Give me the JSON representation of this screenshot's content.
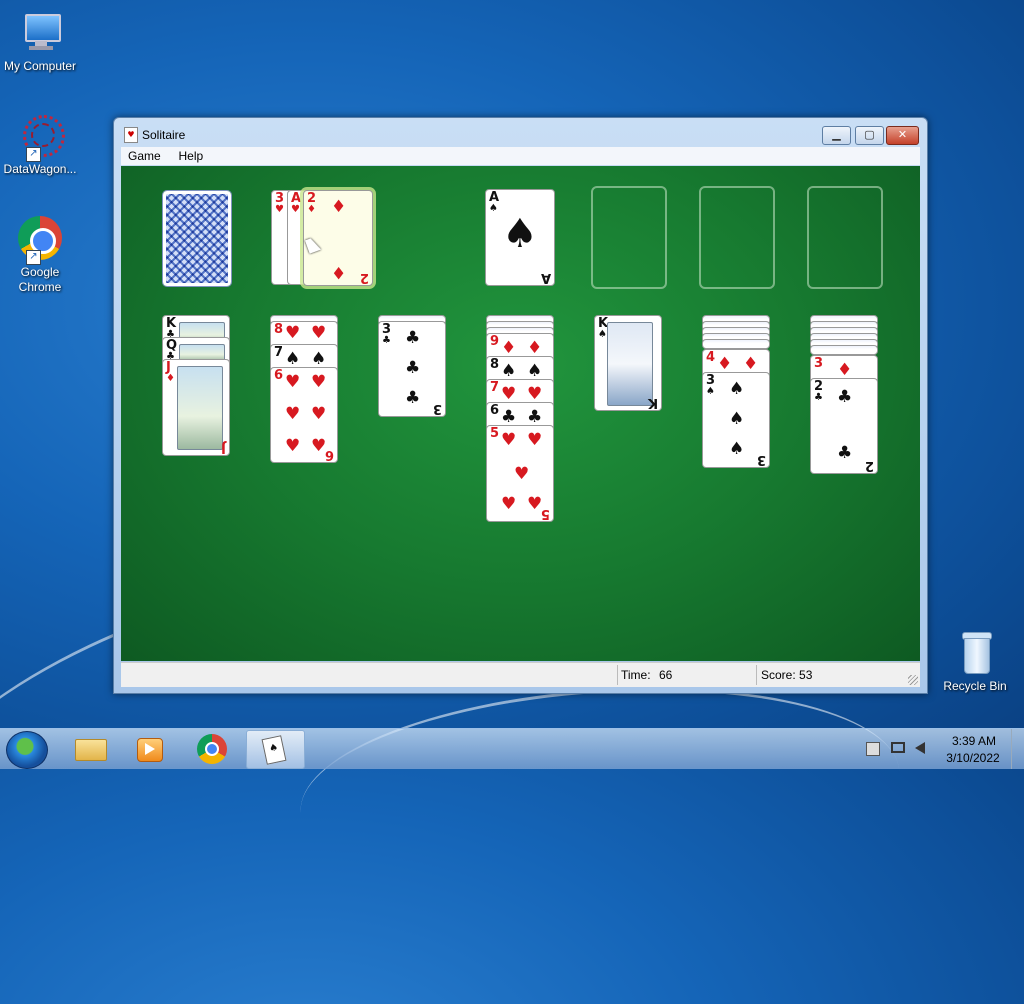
{
  "desktop": {
    "icons": [
      {
        "label": "My Computer"
      },
      {
        "label": "DataWagon..."
      },
      {
        "label": "Google Chrome"
      },
      {
        "label": "Recycle Bin"
      }
    ]
  },
  "window": {
    "title": "Solitaire",
    "controls": {
      "minimize": "▁",
      "maximize": "▢",
      "close": "✕"
    },
    "menu": [
      "Game",
      "Help"
    ],
    "status": {
      "time_label": "Time:",
      "time_value": "66",
      "score_label": "Score: 53"
    }
  },
  "game": {
    "stock": "face-down",
    "waste": [
      {
        "rank": "3",
        "suit": "♥",
        "color": "red"
      },
      {
        "rank": "A",
        "suit": "♥",
        "color": "red"
      },
      {
        "rank": "2",
        "suit": "♦",
        "color": "red",
        "selected": true
      }
    ],
    "foundations": [
      {
        "rank": "A",
        "suit": "♠",
        "color": "black"
      },
      {
        "empty": true
      },
      {
        "empty": true
      },
      {
        "empty": true
      }
    ],
    "tableau": [
      {
        "hidden": 0,
        "cards": [
          {
            "rank": "K",
            "suit": "♣",
            "color": "black"
          },
          {
            "rank": "Q",
            "suit": "♣",
            "color": "black"
          },
          {
            "rank": "J",
            "suit": "♦",
            "color": "red"
          }
        ]
      },
      {
        "hidden": 1,
        "cards": [
          {
            "rank": "8",
            "suit": "♥",
            "color": "red"
          },
          {
            "rank": "7",
            "suit": "♠",
            "color": "black"
          },
          {
            "rank": "6",
            "suit": "♥",
            "color": "red"
          }
        ]
      },
      {
        "hidden": 1,
        "cards": [
          {
            "rank": "3",
            "suit": "♣",
            "color": "black"
          }
        ]
      },
      {
        "hidden": 3,
        "cards": [
          {
            "rank": "9",
            "suit": "♦",
            "color": "red"
          },
          {
            "rank": "8",
            "suit": "♠",
            "color": "black"
          },
          {
            "rank": "7",
            "suit": "♥",
            "color": "red"
          },
          {
            "rank": "6",
            "suit": "♣",
            "color": "black"
          },
          {
            "rank": "5",
            "suit": "♥",
            "color": "red"
          }
        ]
      },
      {
        "hidden": 0,
        "cards": [
          {
            "rank": "K",
            "suit": "♠",
            "color": "black"
          }
        ]
      },
      {
        "hidden": 5,
        "cards": [
          {
            "rank": "4",
            "suit": "♦",
            "color": "red"
          },
          {
            "rank": "3",
            "suit": "♠",
            "color": "black"
          }
        ]
      },
      {
        "hidden": 6,
        "cards": [
          {
            "rank": "3",
            "suit": "♦",
            "color": "red"
          },
          {
            "rank": "2",
            "suit": "♣",
            "color": "black"
          }
        ]
      }
    ]
  },
  "taskbar": {
    "clock_time": "3:39 AM",
    "clock_date": "3/10/2022"
  }
}
